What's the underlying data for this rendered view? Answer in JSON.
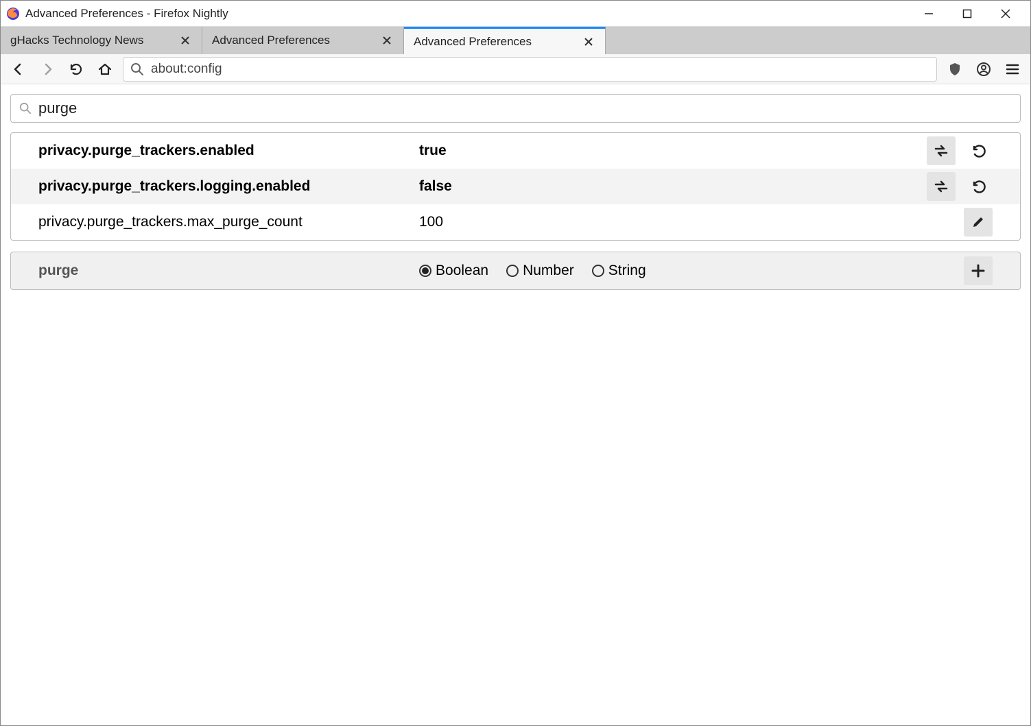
{
  "window": {
    "title": "Advanced Preferences - Firefox Nightly"
  },
  "tabs": [
    {
      "label": "gHacks Technology News",
      "active": false
    },
    {
      "label": "Advanced Preferences",
      "active": false
    },
    {
      "label": "Advanced Preferences",
      "active": true
    }
  ],
  "urlbar": {
    "value": "about:config"
  },
  "search": {
    "value": "purge"
  },
  "prefs": [
    {
      "name": "privacy.purge_trackers.enabled",
      "value": "true",
      "modified": true
    },
    {
      "name": "privacy.purge_trackers.logging.enabled",
      "value": "false",
      "modified": true
    },
    {
      "name": "privacy.purge_trackers.max_purge_count",
      "value": "100",
      "modified": false
    }
  ],
  "new_pref": {
    "name": "purge",
    "types": {
      "boolean": "Boolean",
      "number": "Number",
      "string": "String"
    },
    "selected": "boolean"
  }
}
